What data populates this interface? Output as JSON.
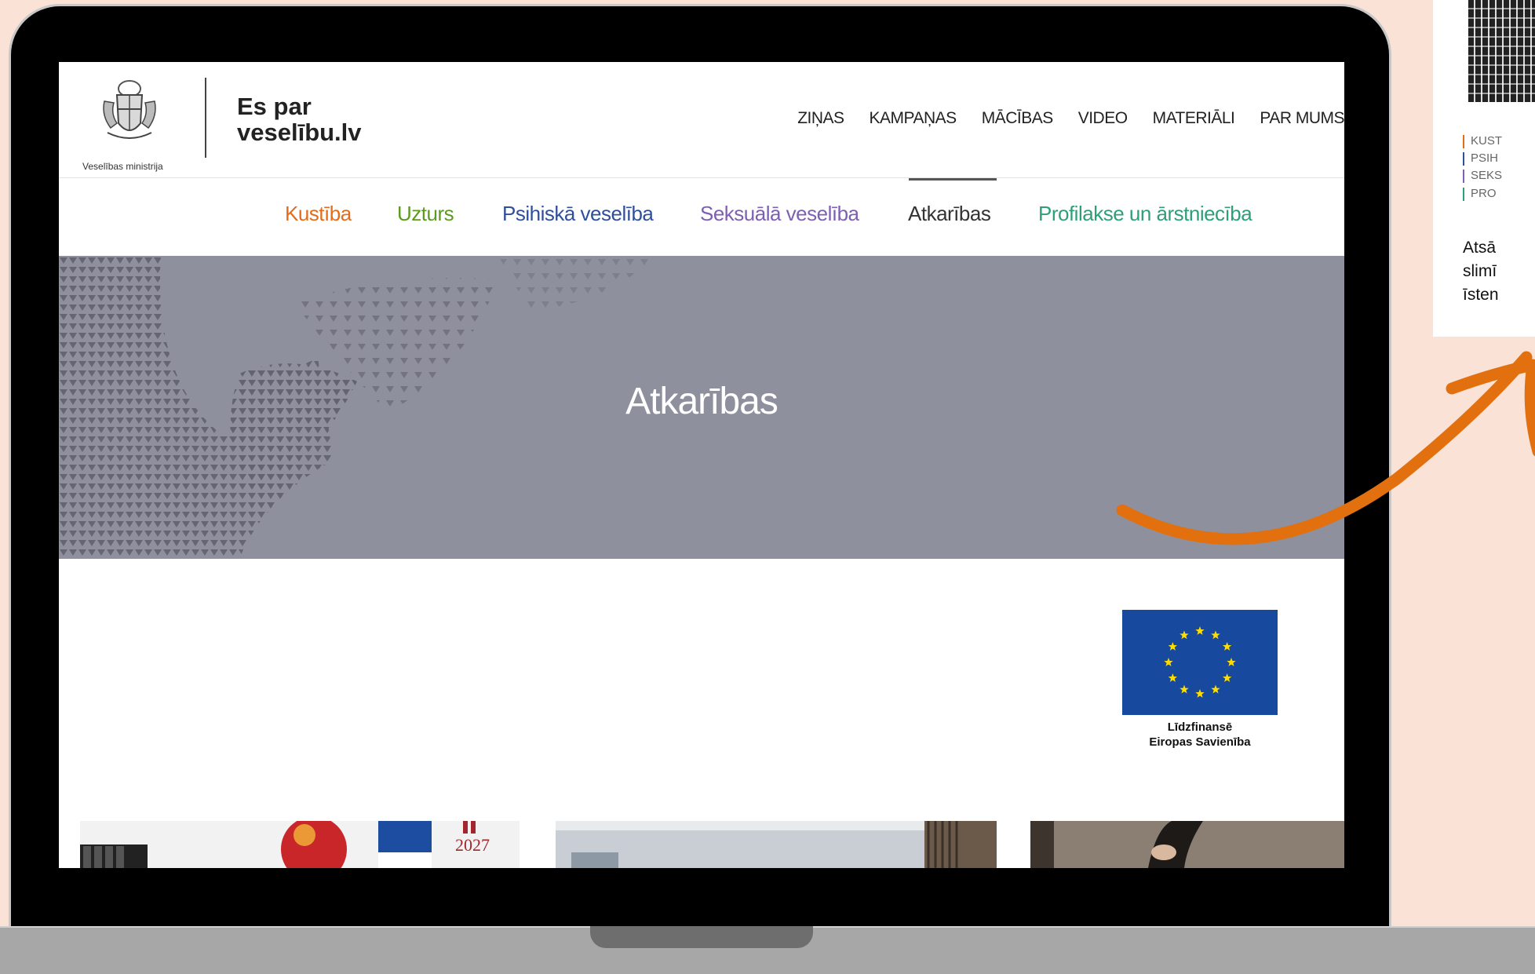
{
  "site": {
    "ministry_name": "Veselības ministrija",
    "name": "Es par veselību.lv"
  },
  "main_nav": [
    {
      "label": "ZIŅAS"
    },
    {
      "label": "KAMPAŅAS"
    },
    {
      "label": "MĀCĪBAS"
    },
    {
      "label": "VIDEO"
    },
    {
      "label": "MATERIĀLI"
    },
    {
      "label": "PAR MUMS"
    }
  ],
  "sub_nav": [
    {
      "label": "Kustība",
      "color": "#e36c1a"
    },
    {
      "label": "Uzturs",
      "color": "#5b9b1e"
    },
    {
      "label": "Psihiskā veselība",
      "color": "#2f4f9c"
    },
    {
      "label": "Seksuālā veselība",
      "color": "#7d5fb3"
    },
    {
      "label": "Atkarības",
      "color": "#333333",
      "active": true
    },
    {
      "label": "Profilakse un ārstniecība",
      "color": "#2f9e7a"
    }
  ],
  "hero": {
    "title": "Atkarības"
  },
  "eu": {
    "caption_line1": "Līdzfinansē",
    "caption_line2": "Eiropas Savienība"
  },
  "thumbnails": [
    {
      "name": "thumb-1",
      "badge": "2027"
    },
    {
      "name": "thumb-2"
    },
    {
      "name": "thumb-3"
    }
  ],
  "preview": {
    "categories": [
      {
        "label": "KUST",
        "color": "#e36c1a"
      },
      {
        "label": "PSIH",
        "color": "#2f4f9c"
      },
      {
        "label": "SEKS",
        "color": "#7d5fb3"
      },
      {
        "label": "PRO",
        "color": "#2f9e7a"
      }
    ],
    "text_lines": [
      "Atsā",
      "slimī",
      "īsten"
    ]
  },
  "colors": {
    "background": "#fbe2d6",
    "arrow": "#e3700f",
    "hero": "#8e909e",
    "eu_blue": "#174a9e",
    "eu_star": "#ffdd00"
  }
}
